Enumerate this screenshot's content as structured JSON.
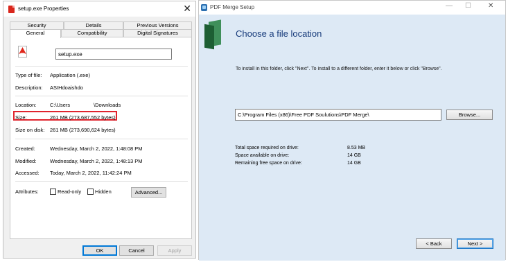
{
  "properties": {
    "title": "setup.exe Properties",
    "close_glyph": "✕",
    "tabs_top": [
      "Security",
      "Details",
      "Previous Versions"
    ],
    "tabs_bottom": [
      "General",
      "Compatibility",
      "Digital Signatures"
    ],
    "file_name": "setup.exe",
    "fields": {
      "type_label": "Type of file:",
      "type_value": "Application (.exe)",
      "desc_label": "Description:",
      "desc_value": "ASIHdoaishdo",
      "location_label": "Location:",
      "location_value_1": "C:\\Users",
      "location_value_2": "\\Downloads",
      "size_label": "Size:",
      "size_value": "261 MB (273,687,552 bytes)",
      "size_on_disk_label": "Size on disk:",
      "size_on_disk_value": "261 MB (273,690,624 bytes)",
      "created_label": "Created:",
      "created_value": "Wednesday, March 2, 2022, 1:48:08 PM",
      "modified_label": "Modified:",
      "modified_value": "Wednesday, March 2, 2022, 1:48:13 PM",
      "accessed_label": "Accessed:",
      "accessed_value": "Today, March 2, 2022, 11:42:24 PM",
      "attributes_label": "Attributes:",
      "readonly_label": "Read-only",
      "hidden_label": "Hidden"
    },
    "buttons": {
      "advanced": "Advanced...",
      "ok": "OK",
      "cancel": "Cancel",
      "apply": "Apply"
    },
    "highlight_color": "#e0242e"
  },
  "setup": {
    "title": "PDF Merge Setup",
    "window_controls": {
      "minimize": "—",
      "maximize": "☐",
      "close": "✕"
    },
    "heading": "Choose a file location",
    "instruction": "To install in this folder, click \"Next\". To install to a different folder, enter it below or click \"Browse\".",
    "path": "C:\\Program Files (x86)\\Free PDF Soulutions\\PDF Merge\\",
    "browse": "Browse...",
    "space": [
      {
        "label": "Total space required on drive:",
        "value": "8.53 MB"
      },
      {
        "label": "Space available on drive:",
        "value": "14 GB"
      },
      {
        "label": "Remaining free space on drive:",
        "value": "14 GB"
      }
    ],
    "back": "< Back",
    "next": "Next >",
    "heading_color": "#163a7a",
    "background_color": "#dde9f5"
  }
}
